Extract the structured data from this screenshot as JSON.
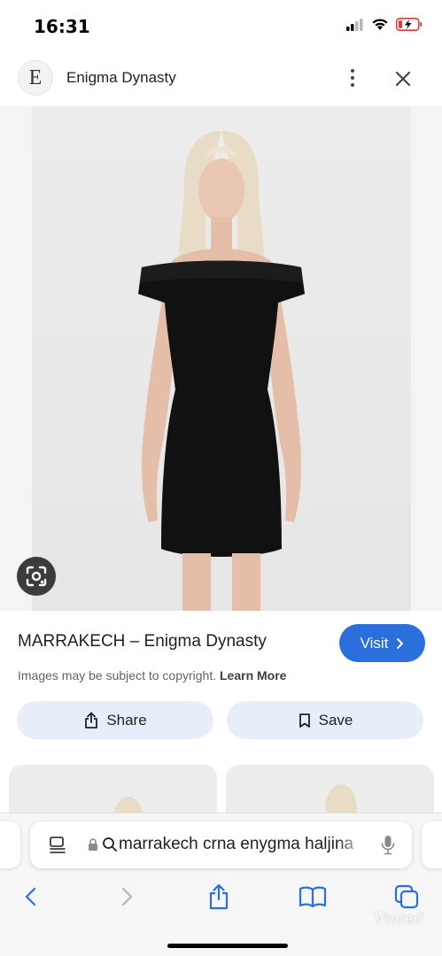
{
  "status": {
    "time": "16:31"
  },
  "header": {
    "site_initial": "E",
    "site_name": "Enigma Dynasty"
  },
  "result": {
    "title": "MARRAKECH – Enigma Dynasty",
    "visit_label": "Visit",
    "copyright_text": "Images may be subject to copyright.",
    "learn_more": "Learn More"
  },
  "actions": {
    "share_label": "Share",
    "save_label": "Save"
  },
  "browser": {
    "url_text": "marrakech crna enygma haljina"
  },
  "watermark": "Vinted",
  "colors": {
    "accent": "#2a6fdb",
    "action_bg": "#e8eef9",
    "safari_blue": "#2a6fdb"
  },
  "icons": [
    "signal-icon",
    "wifi-icon",
    "battery-icon",
    "more-vert-icon",
    "close-icon",
    "lens-icon",
    "chevron-right-icon",
    "share-icon",
    "bookmark-icon",
    "reader-icon",
    "lock-icon",
    "search-icon",
    "mic-icon",
    "back-icon",
    "forward-icon",
    "share-sheet-icon",
    "bookmarks-icon",
    "tabs-icon"
  ]
}
